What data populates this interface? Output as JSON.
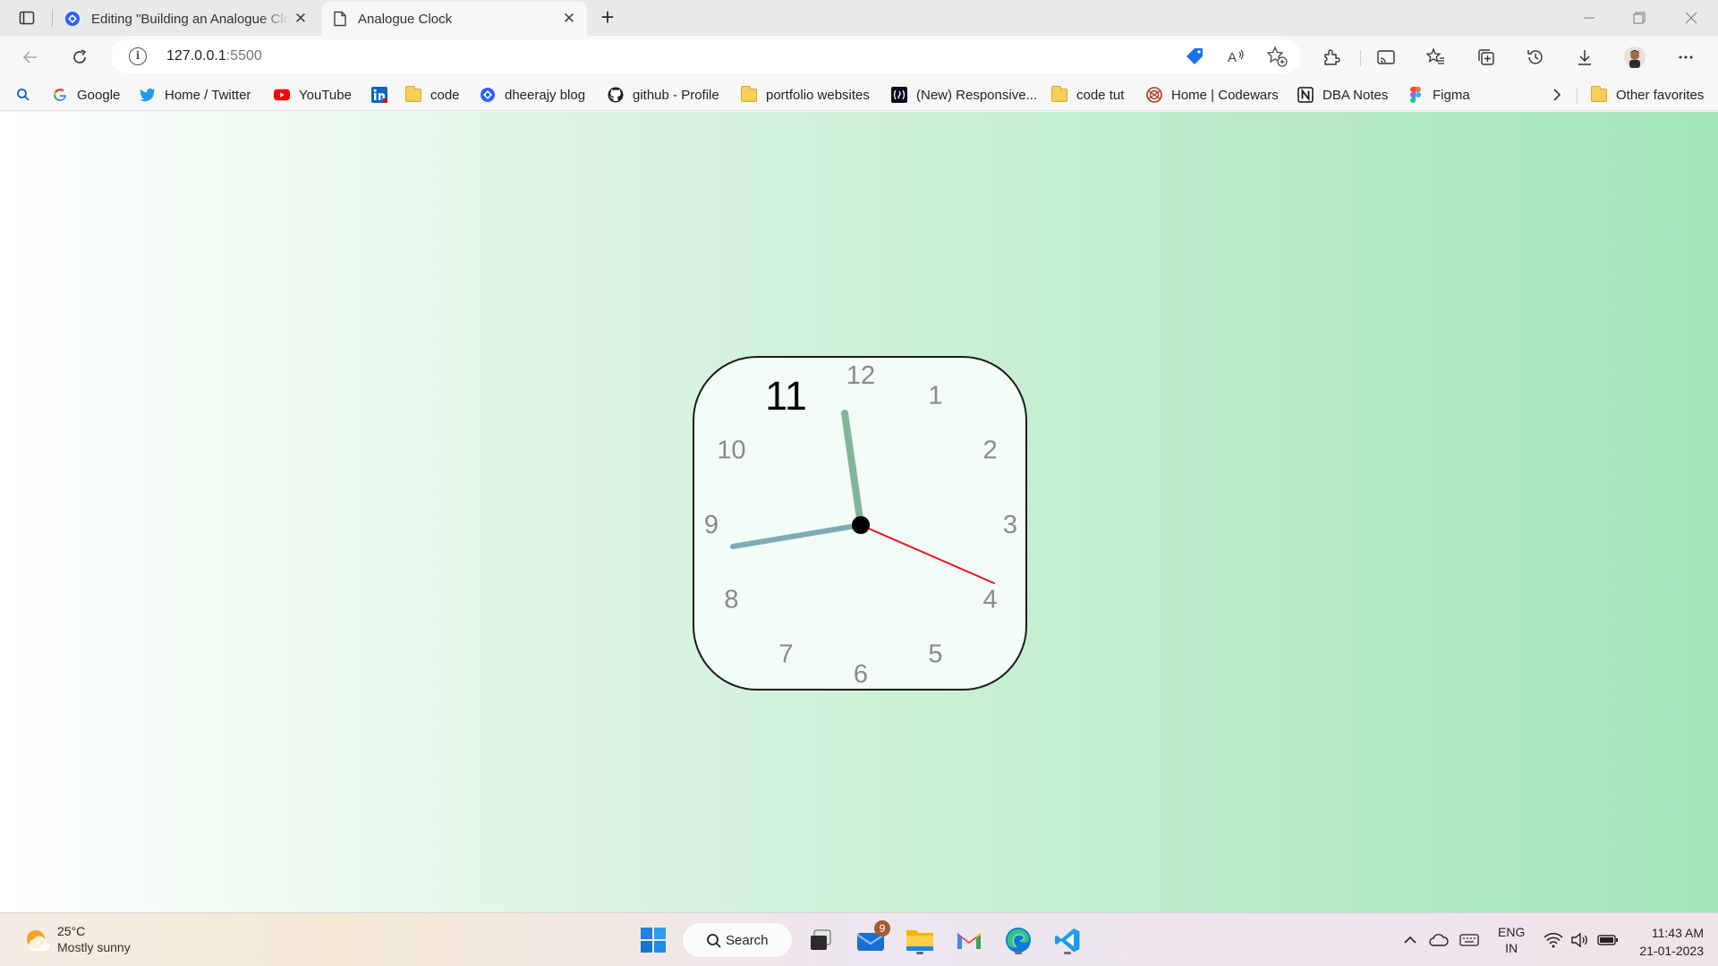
{
  "browser": {
    "tabs": [
      {
        "title": "Editing \"Building an Analogue Clock",
        "icon": "edge-blog-icon"
      },
      {
        "title": "Analogue Clock",
        "icon": "page-icon",
        "active": true
      }
    ],
    "address": {
      "host": "127.0.0.1",
      "port": ":5500"
    },
    "favorites": [
      {
        "label": "Google",
        "icon": "google-icon"
      },
      {
        "label": "Home / Twitter",
        "icon": "twitter-icon"
      },
      {
        "label": "YouTube",
        "icon": "youtube-icon"
      },
      {
        "label": "",
        "icon": "linkedin-icon"
      },
      {
        "label": "code",
        "icon": "folder-icon"
      },
      {
        "label": "dheerajy blog",
        "icon": "blog-icon"
      },
      {
        "label": "github - Profile",
        "icon": "github-icon"
      },
      {
        "label": "portfolio websites",
        "icon": "folder-icon"
      },
      {
        "label": "(New) Responsive...",
        "icon": "freecodecamp-icon"
      },
      {
        "label": "code tut",
        "icon": "folder-icon"
      },
      {
        "label": "Home | Codewars",
        "icon": "codewars-icon"
      },
      {
        "label": "DBA Notes",
        "icon": "notion-icon"
      },
      {
        "label": "Figma",
        "icon": "figma-icon"
      }
    ],
    "other_favorites": "Other favorites"
  },
  "clock": {
    "numbers": [
      "12",
      "1",
      "2",
      "3",
      "4",
      "5",
      "6",
      "7",
      "8",
      "9",
      "10",
      "11"
    ],
    "active_hour": "11",
    "hand_colors": {
      "hour": "#7fb69a",
      "minute": "#7faab6",
      "second": "#e8161b"
    }
  },
  "taskbar": {
    "weather": {
      "temp": "25°C",
      "desc": "Mostly sunny"
    },
    "search_label": "Search",
    "mail_badge": "9",
    "lang": {
      "line1": "ENG",
      "line2": "IN"
    },
    "time": "11:43 AM",
    "date": "21-01-2023"
  }
}
